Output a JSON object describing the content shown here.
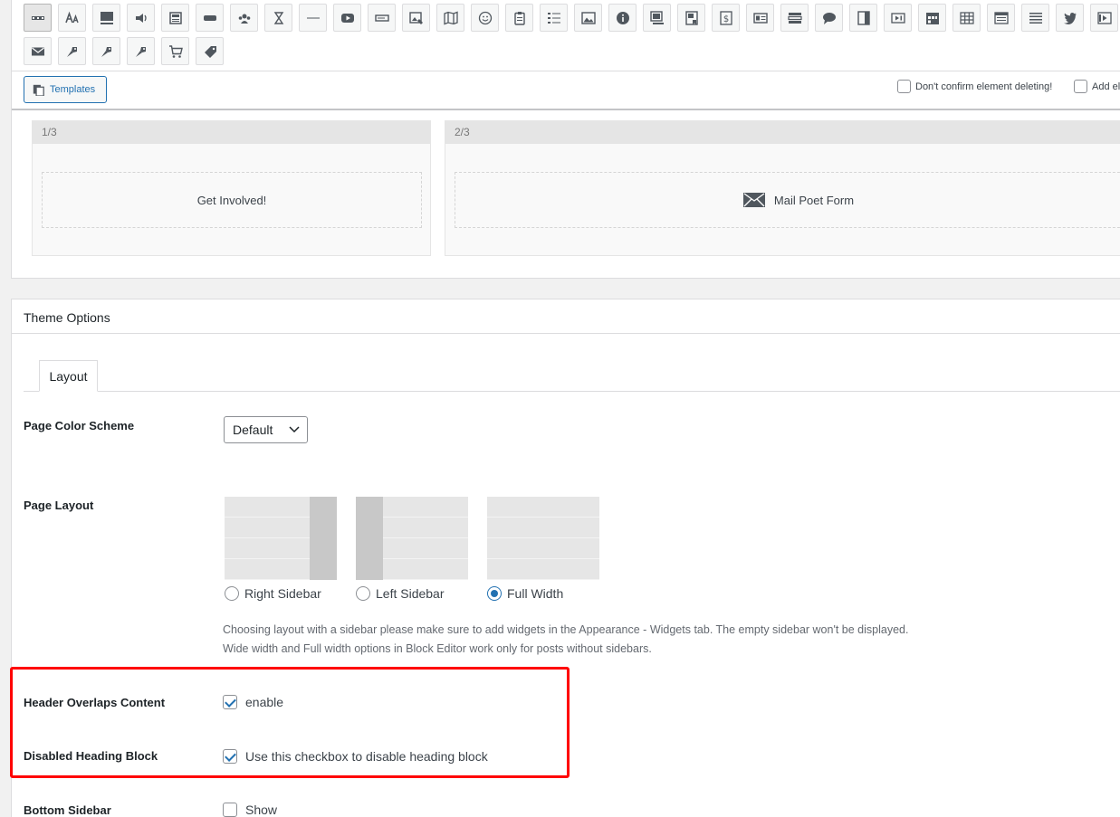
{
  "toolbar": {
    "row1_icons": [
      "rows-icon",
      "text-size-icon",
      "heading-icon",
      "megaphone-icon",
      "news-icon",
      "button-icon",
      "team-icon",
      "hourglass-icon",
      "divider-icon",
      "video-icon",
      "input-icon",
      "image-edit-icon",
      "map-icon",
      "smiley-icon",
      "clipboard-icon",
      "list-icon",
      "image-icon",
      "info-icon",
      "gallery-icon",
      "bookmark-icon",
      "dollar-icon",
      "id-card-icon",
      "stack-icon",
      "chat-icon",
      "sidebar-icon",
      "media-player-icon",
      "calendar-icon",
      "table-icon",
      "newspaper-icon",
      "align-justify-icon",
      "twitter-icon",
      "film-icon"
    ],
    "row2_icons": [
      "envelope-icon",
      "tag-icon",
      "tag-icon",
      "tag-icon",
      "cart-icon",
      "price-tag-icon"
    ]
  },
  "builder": {
    "templates_label": "Templates",
    "confirm_delete_label": "Don't confirm element deleting!",
    "add_el_label": "Add el",
    "columns": [
      {
        "head": "1/3",
        "content": "Get Involved!"
      },
      {
        "head": "2/3",
        "content": "Mail Poet Form"
      }
    ]
  },
  "theme_options": {
    "title": "Theme Options",
    "tab": "Layout",
    "color_scheme": {
      "label": "Page Color Scheme",
      "value": "Default"
    },
    "page_layout": {
      "label": "Page Layout",
      "options": [
        {
          "label": "Right Sidebar",
          "selected": false
        },
        {
          "label": "Left Sidebar",
          "selected": false
        },
        {
          "label": "Full Width",
          "selected": true
        }
      ],
      "description_1": "Choosing layout with a sidebar please make sure to add widgets in the Appearance - Widgets tab. The empty sidebar won't be displayed.",
      "description_2": "Wide width and Full width options in Block Editor work only for posts without sidebars."
    },
    "header_overlaps": {
      "label": "Header Overlaps Content",
      "checkbox_label": "enable",
      "checked": true
    },
    "disabled_heading": {
      "label": "Disabled Heading Block",
      "checkbox_label": "Use this checkbox to disable heading block",
      "checked": true
    },
    "bottom_sidebar": {
      "label": "Bottom Sidebar",
      "checkbox_label": "Show",
      "checked": false
    }
  },
  "colors": {
    "accent": "#2271b1",
    "highlight": "#ff0000",
    "sidebar_block": "#c8c8c8"
  }
}
